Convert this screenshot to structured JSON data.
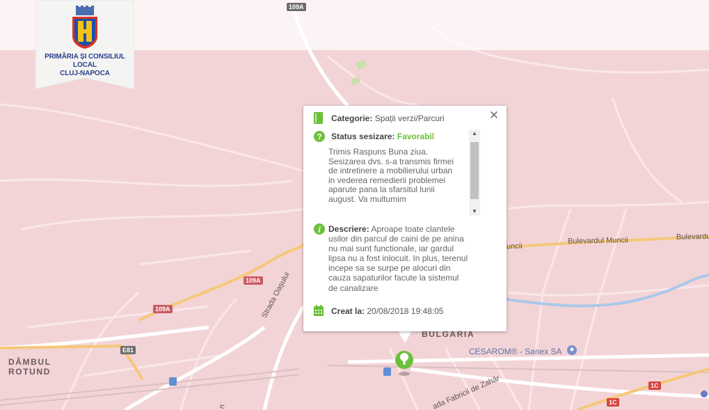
{
  "logo": {
    "line1": "PRIMĂRIA ȘI CONSILIUL LOCAL",
    "line2": "CLUJ-NAPOCA"
  },
  "map": {
    "areas": [
      {
        "line1": "DÂMBUL",
        "line2": "ROTUND"
      },
      {
        "line1": "BULGARIA"
      }
    ],
    "streets": {
      "bulevardul_muncii_1": "Bulevardul Muncii",
      "bulevardul_muncii_2": "Bulevardul Muncii",
      "bulevardul_muncii_left": "uncii",
      "strada_oasului": "Strada Oașului",
      "strada_fabricii": "ada Fabricii de Zahăr",
      "bottom_fragment": "n"
    },
    "shields": {
      "top": "109A",
      "mid": "109A",
      "left": "109A",
      "e81": "E81",
      "c1a": "1C",
      "c1b": "1C"
    },
    "poi": "CESAROM® - Sanex SA",
    "colors": {
      "overlay": "#f3d4d6",
      "road_major": "#f5c77a",
      "road": "#ffffff",
      "water": "#a9c8ea",
      "marker": "#6cbf3b"
    }
  },
  "popup": {
    "category_label": "Categorie:",
    "category_value": "Spații verzi/Parcuri",
    "status_label": "Status sesizare:",
    "status_value": "Favorabil",
    "response_lines": [
      "Trimis Raspuns Buna ziua.",
      "Sesizarea dvs. s-a transmis firmei",
      "de intretinere a mobilierului urban",
      "in vederea remedierii problemei",
      "aparute pana la sfarsitul lunii",
      "august. Va multumim"
    ],
    "description_label": "Descriere:",
    "description_lines": [
      "Aproape toate clantele",
      "usilor din parcul de caini de pe anina",
      "nu mai sunt functionale, iar gardul",
      "lipsa nu a fost inlocuit. In plus, terenul",
      "incepe sa se surpe pe alocuri din",
      "cauza sapaturilor facute la sistemul",
      "de canalizare"
    ],
    "created_label": "Creat la:",
    "created_value": "20/08/2018 19:48:05",
    "icons": [
      "book-icon",
      "question-icon",
      "info-icon",
      "calendar-icon",
      "close-icon"
    ]
  }
}
